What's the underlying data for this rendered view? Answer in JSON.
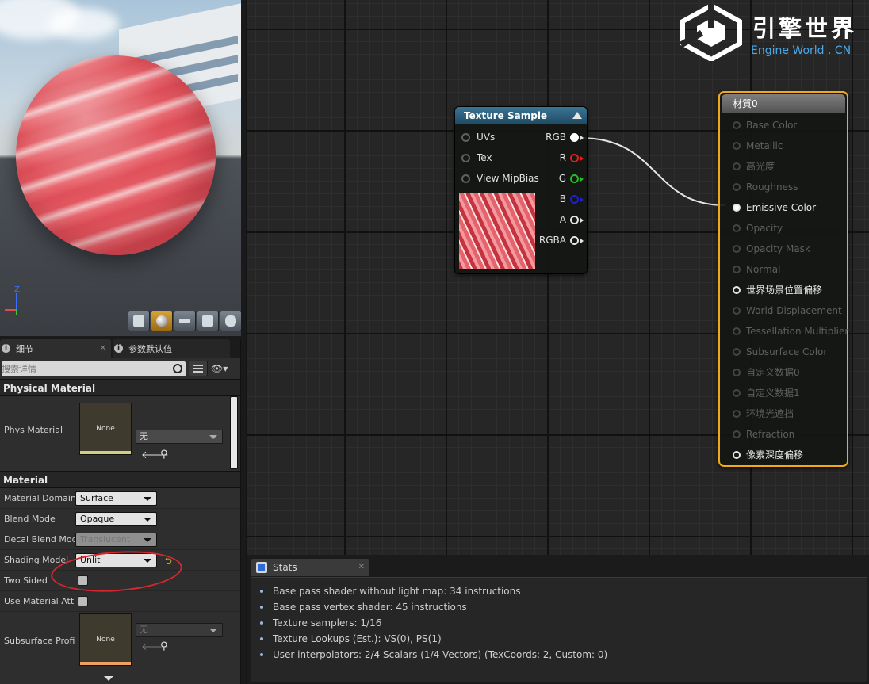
{
  "details": {
    "tabs": [
      {
        "label": "细节"
      },
      {
        "label": "参数默认值"
      }
    ],
    "search": {
      "placeholder": "搜索详情"
    },
    "physical_material": {
      "header": "Physical Material",
      "phys_label": "Phys Material",
      "thumb_text": "None",
      "asset_value": "无"
    },
    "material": {
      "header": "Material",
      "rows": [
        {
          "label": "Material Domain",
          "value": "Surface"
        },
        {
          "label": "Blend Mode",
          "value": "Opaque"
        },
        {
          "label": "Decal Blend Mode",
          "value": "Translucent"
        },
        {
          "label": "Shading Model",
          "value": "Unlit"
        },
        {
          "label": "Two Sided"
        },
        {
          "label": "Use Material Attri"
        }
      ],
      "subsurface": {
        "label": "Subsurface Profil",
        "thumb_text": "None",
        "asset_value": "无"
      }
    }
  },
  "viewport": {
    "axis_z": "Z"
  },
  "graph": {
    "logo": {
      "title": "引擎世界",
      "subtitle": "Engine World . CN"
    },
    "texture_node": {
      "title": "Texture Sample",
      "inputs": [
        "UVs",
        "Tex",
        "View MipBias"
      ],
      "outputs": [
        "RGB",
        "R",
        "G",
        "B",
        "A",
        "RGBA"
      ]
    },
    "material_node": {
      "title": "材質0",
      "pins": [
        "Base Color",
        "Metallic",
        "高光度",
        "Roughness",
        "Emissive Color",
        "Opacity",
        "Opacity Mask",
        "Normal",
        "世界场景位置偏移",
        "World Displacement",
        "Tessellation Multiplier",
        "Subsurface Color",
        "自定义数据0",
        "自定义数据1",
        "环境光遮挡",
        "Refraction",
        "像素深度偏移"
      ]
    }
  },
  "stats": {
    "tab_label": "Stats",
    "lines": [
      "Base pass shader without light map: 34 instructions",
      "Base pass vertex shader: 45 instructions",
      "Texture samplers: 1/16",
      "Texture Lookups (Est.): VS(0), PS(1)",
      "User interpolators: 2/4 Scalars (1/4 Vectors) (TexCoords: 2, Custom: 0)"
    ]
  },
  "colors": {
    "accent_orange": "#f0a81e",
    "node_header_blue": "#2f6b8c",
    "highlight_red": "#d8262e",
    "logo_blue": "#4aa8e8"
  }
}
